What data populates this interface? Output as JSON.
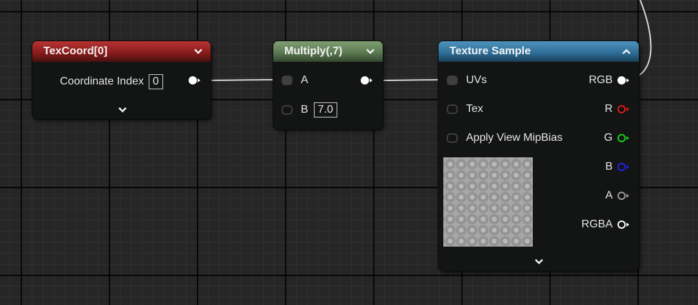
{
  "canvas": {
    "background": "#262626",
    "grid_minor": "#303030",
    "grid_major": "#000000"
  },
  "nodes": {
    "texcoord": {
      "title": "TexCoord[0]",
      "header_color": "#8a1c1c",
      "header_icon": "chevron-down-icon",
      "param_label": "Coordinate Index",
      "param_value": "0",
      "footer_icon": "chevron-down-icon"
    },
    "multiply": {
      "title": "Multiply(,7)",
      "header_color": "#5c7a52",
      "header_icon": "chevron-down-icon",
      "input_a_label": "A",
      "input_b_label": "B",
      "input_b_value": "7.0"
    },
    "texture_sample": {
      "title": "Texture Sample",
      "header_color": "#2f6f99",
      "header_icon": "chevron-up-icon",
      "inputs": [
        "UVs",
        "Tex",
        "Apply View MipBias"
      ],
      "outputs": [
        {
          "label": "RGB",
          "color": "#ffffff"
        },
        {
          "label": "R",
          "color": "#e01a1a"
        },
        {
          "label": "G",
          "color": "#1ad41a"
        },
        {
          "label": "B",
          "color": "#2020e8"
        },
        {
          "label": "A",
          "color": "#9a9a9a"
        },
        {
          "label": "RGBA",
          "color": "#ffffff"
        }
      ],
      "preview": "gray-texture-preview",
      "footer_icon": "chevron-down-icon"
    }
  },
  "wires": {
    "color": "#d8d8d8"
  }
}
